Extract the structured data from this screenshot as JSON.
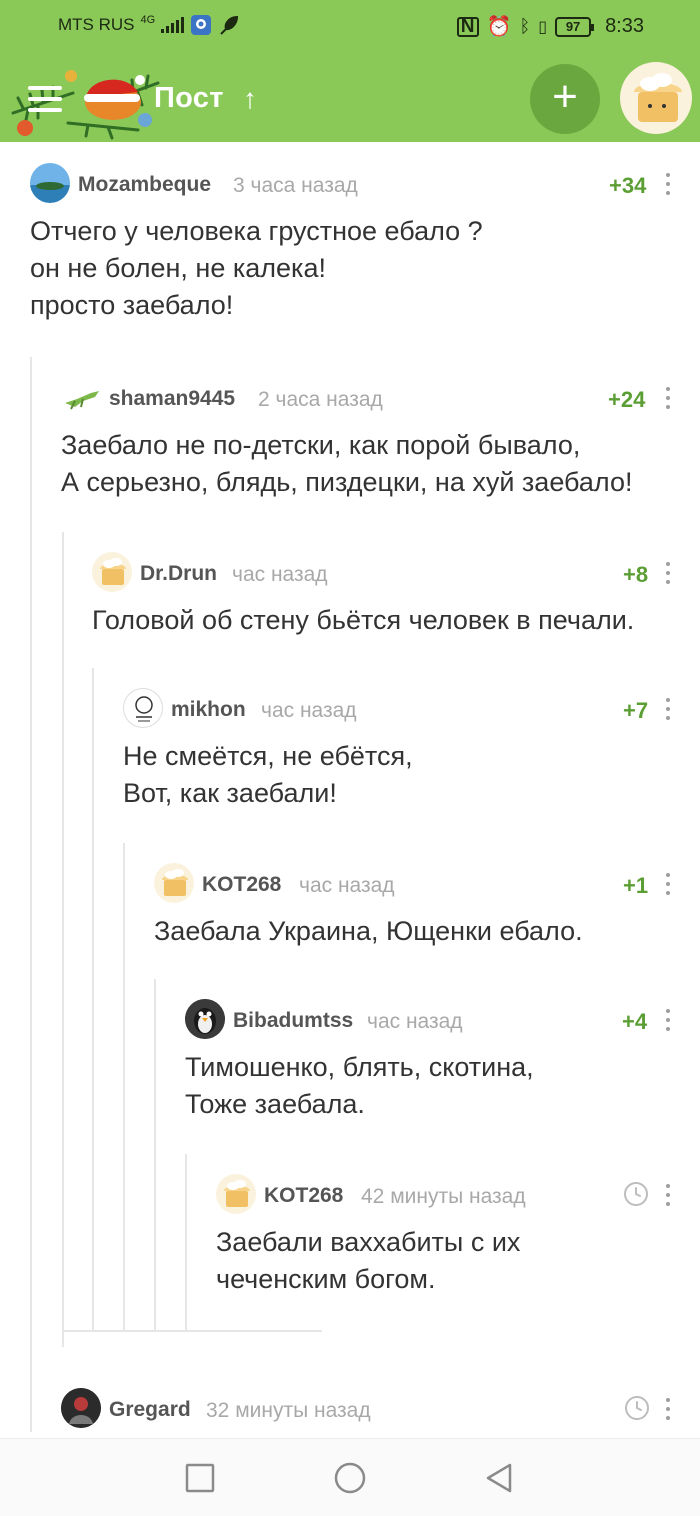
{
  "status_bar": {
    "carrier": "MTS RUS",
    "network": "4G",
    "battery": "97",
    "time": "8:33"
  },
  "header": {
    "title": "Пост",
    "icons": [
      "menu-icon",
      "arrow-up-icon",
      "plus-icon"
    ]
  },
  "comments": [
    {
      "username": "Mozambeque",
      "time": "3 часа назад",
      "rating": "+34",
      "text": "Отчего у человека грустное ебало ?\nон не болен, не калека!\nпросто заебало!"
    },
    {
      "username": "shaman9445",
      "time": "2 часа назад",
      "rating": "+24",
      "text": "Заебало не по-детски, как порой бывало,\nА серьезно, блядь, пиздецки, на хуй заебало!"
    },
    {
      "username": "Dr.Drun",
      "time": "час назад",
      "rating": "+8",
      "text": "Головой об стену бьётся человек в печали."
    },
    {
      "username": "mikhon",
      "time": "час назад",
      "rating": "+7",
      "text": "Не смеётся, не ебётся,\nВот, как заебали!"
    },
    {
      "username": "KOT268",
      "time": "час назад",
      "rating": "+1",
      "text": "Заебала Украина, Ющенки ебало."
    },
    {
      "username": "Bibadumtss",
      "time": "час назад",
      "rating": "+4",
      "text": "Тимошенко, блять, скотина,\nТоже заебала."
    },
    {
      "username": "KOT268",
      "time": "42 минуты назад",
      "rating": "",
      "text": "Заебали ваххабиты с их\nчеченским богом."
    },
    {
      "username": "Gregard",
      "time": "32 минуты назад",
      "rating": "",
      "text": ""
    }
  ],
  "nav": {
    "icons": [
      "square-icon",
      "circle-icon",
      "back-triangle-icon"
    ]
  },
  "colors": {
    "header_green": "#8ac858",
    "rating_green": "#5b9e34",
    "meta_gray": "#a8a8a8"
  }
}
